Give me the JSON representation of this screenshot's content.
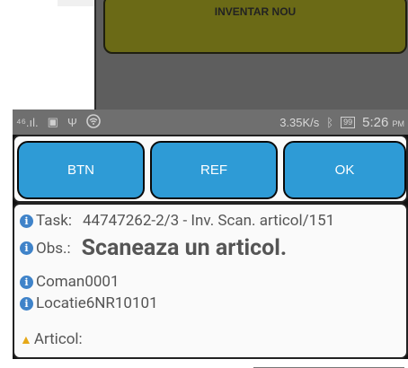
{
  "previous_screen": {
    "button_label": "INVENTAR NOU"
  },
  "status_bar": {
    "signal": "⁴⁶.ıl.",
    "speed": "3.35K/s",
    "battery": "99",
    "time": "5:26",
    "ampm": "PM"
  },
  "toolbar": {
    "btn1_label": "BTN",
    "btn2_label": "REF",
    "btn3_label": "OK"
  },
  "info": {
    "task_label": "Task:",
    "task_value": "44747262-2/3 - Inv. Scan. articol/151",
    "obs_label": "Obs.:",
    "obs_value": "Scaneaza un articol.",
    "comanda_label": "Coman",
    "comanda_value": "0001",
    "locatie_label": "Locatie",
    "locatie_value": "6NR10101",
    "articol_label": "Articol:",
    "articol_value": ""
  },
  "colors": {
    "accent": "#2e9bd6",
    "info_icon": "#3f83c9",
    "warning_icon": "#e6a817"
  },
  "icons": [
    "signal-icon",
    "image-icon",
    "usb-icon",
    "wifi-icon",
    "bluetooth-icon",
    "battery-icon",
    "info-icon",
    "warning-icon"
  ]
}
